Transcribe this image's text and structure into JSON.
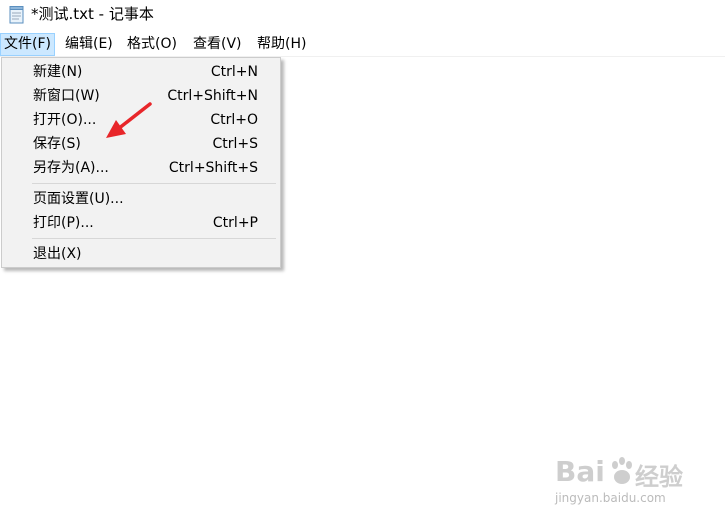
{
  "window": {
    "title": "*测试.txt - 记事本",
    "icon": "notepad-icon"
  },
  "menubar": {
    "items": [
      {
        "label": "文件(F)",
        "active": true
      },
      {
        "label": "编辑(E)"
      },
      {
        "label": "格式(O)"
      },
      {
        "label": "查看(V)"
      },
      {
        "label": "帮助(H)"
      }
    ]
  },
  "file_menu": {
    "items": [
      {
        "label": "新建(N)",
        "shortcut": "Ctrl+N"
      },
      {
        "label": "新窗口(W)",
        "shortcut": "Ctrl+Shift+N"
      },
      {
        "label": "打开(O)...",
        "shortcut": "Ctrl+O"
      },
      {
        "label": "保存(S)",
        "shortcut": "Ctrl+S"
      },
      {
        "label": "另存为(A)...",
        "shortcut": "Ctrl+Shift+S"
      },
      {
        "label": "页面设置(U)...",
        "shortcut": ""
      },
      {
        "label": "打印(P)...",
        "shortcut": "Ctrl+P"
      },
      {
        "label": "退出(X)",
        "shortcut": ""
      }
    ]
  },
  "annotation": {
    "arrow_color": "#e8262a"
  },
  "watermark": {
    "brand": "Bai",
    "brand2": "du",
    "product": "经验",
    "url": "jingyan.baidu.com"
  },
  "colors": {
    "menu_active_bg": "#cce8ff",
    "menu_active_border": "#99d1ff",
    "dropdown_bg": "#f2f2f2"
  }
}
